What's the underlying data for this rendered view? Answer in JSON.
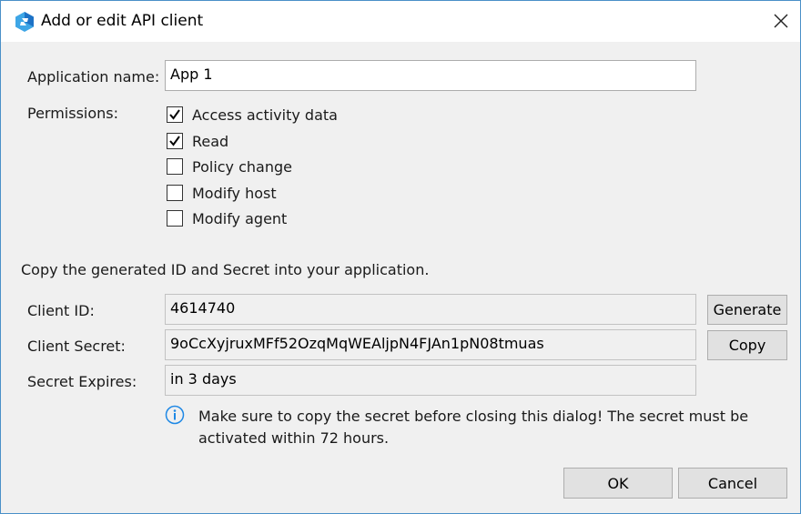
{
  "window": {
    "title": "Add or edit API client"
  },
  "form": {
    "app_name_label": "Application name:",
    "app_name_value": "App 1",
    "permissions_label": "Permissions:",
    "permissions": [
      {
        "label": "Access activity data",
        "checked": true
      },
      {
        "label": "Read",
        "checked": true
      },
      {
        "label": "Policy change",
        "checked": false
      },
      {
        "label": "Modify host",
        "checked": false
      },
      {
        "label": "Modify agent",
        "checked": false
      }
    ]
  },
  "credentials": {
    "instruction": "Copy the generated ID and Secret into your application.",
    "client_id_label": "Client ID:",
    "client_id_value": "4614740",
    "client_secret_label": "Client Secret:",
    "client_secret_value": "9oCcXyjruxMFf52OzqMqWEAljpN4FJAn1pN08tmuas",
    "secret_expires_label": "Secret Expires:",
    "secret_expires_value": "in 3 days",
    "generate_label": "Generate",
    "copy_label": "Copy"
  },
  "info": {
    "message": "Make sure to copy the secret before closing this dialog! The secret must be activated within 72 hours."
  },
  "footer": {
    "ok_label": "OK",
    "cancel_label": "Cancel"
  },
  "colors": {
    "accent": "#0078d7",
    "info_icon": "#1e88e5",
    "window_border": "#4a90c8"
  }
}
